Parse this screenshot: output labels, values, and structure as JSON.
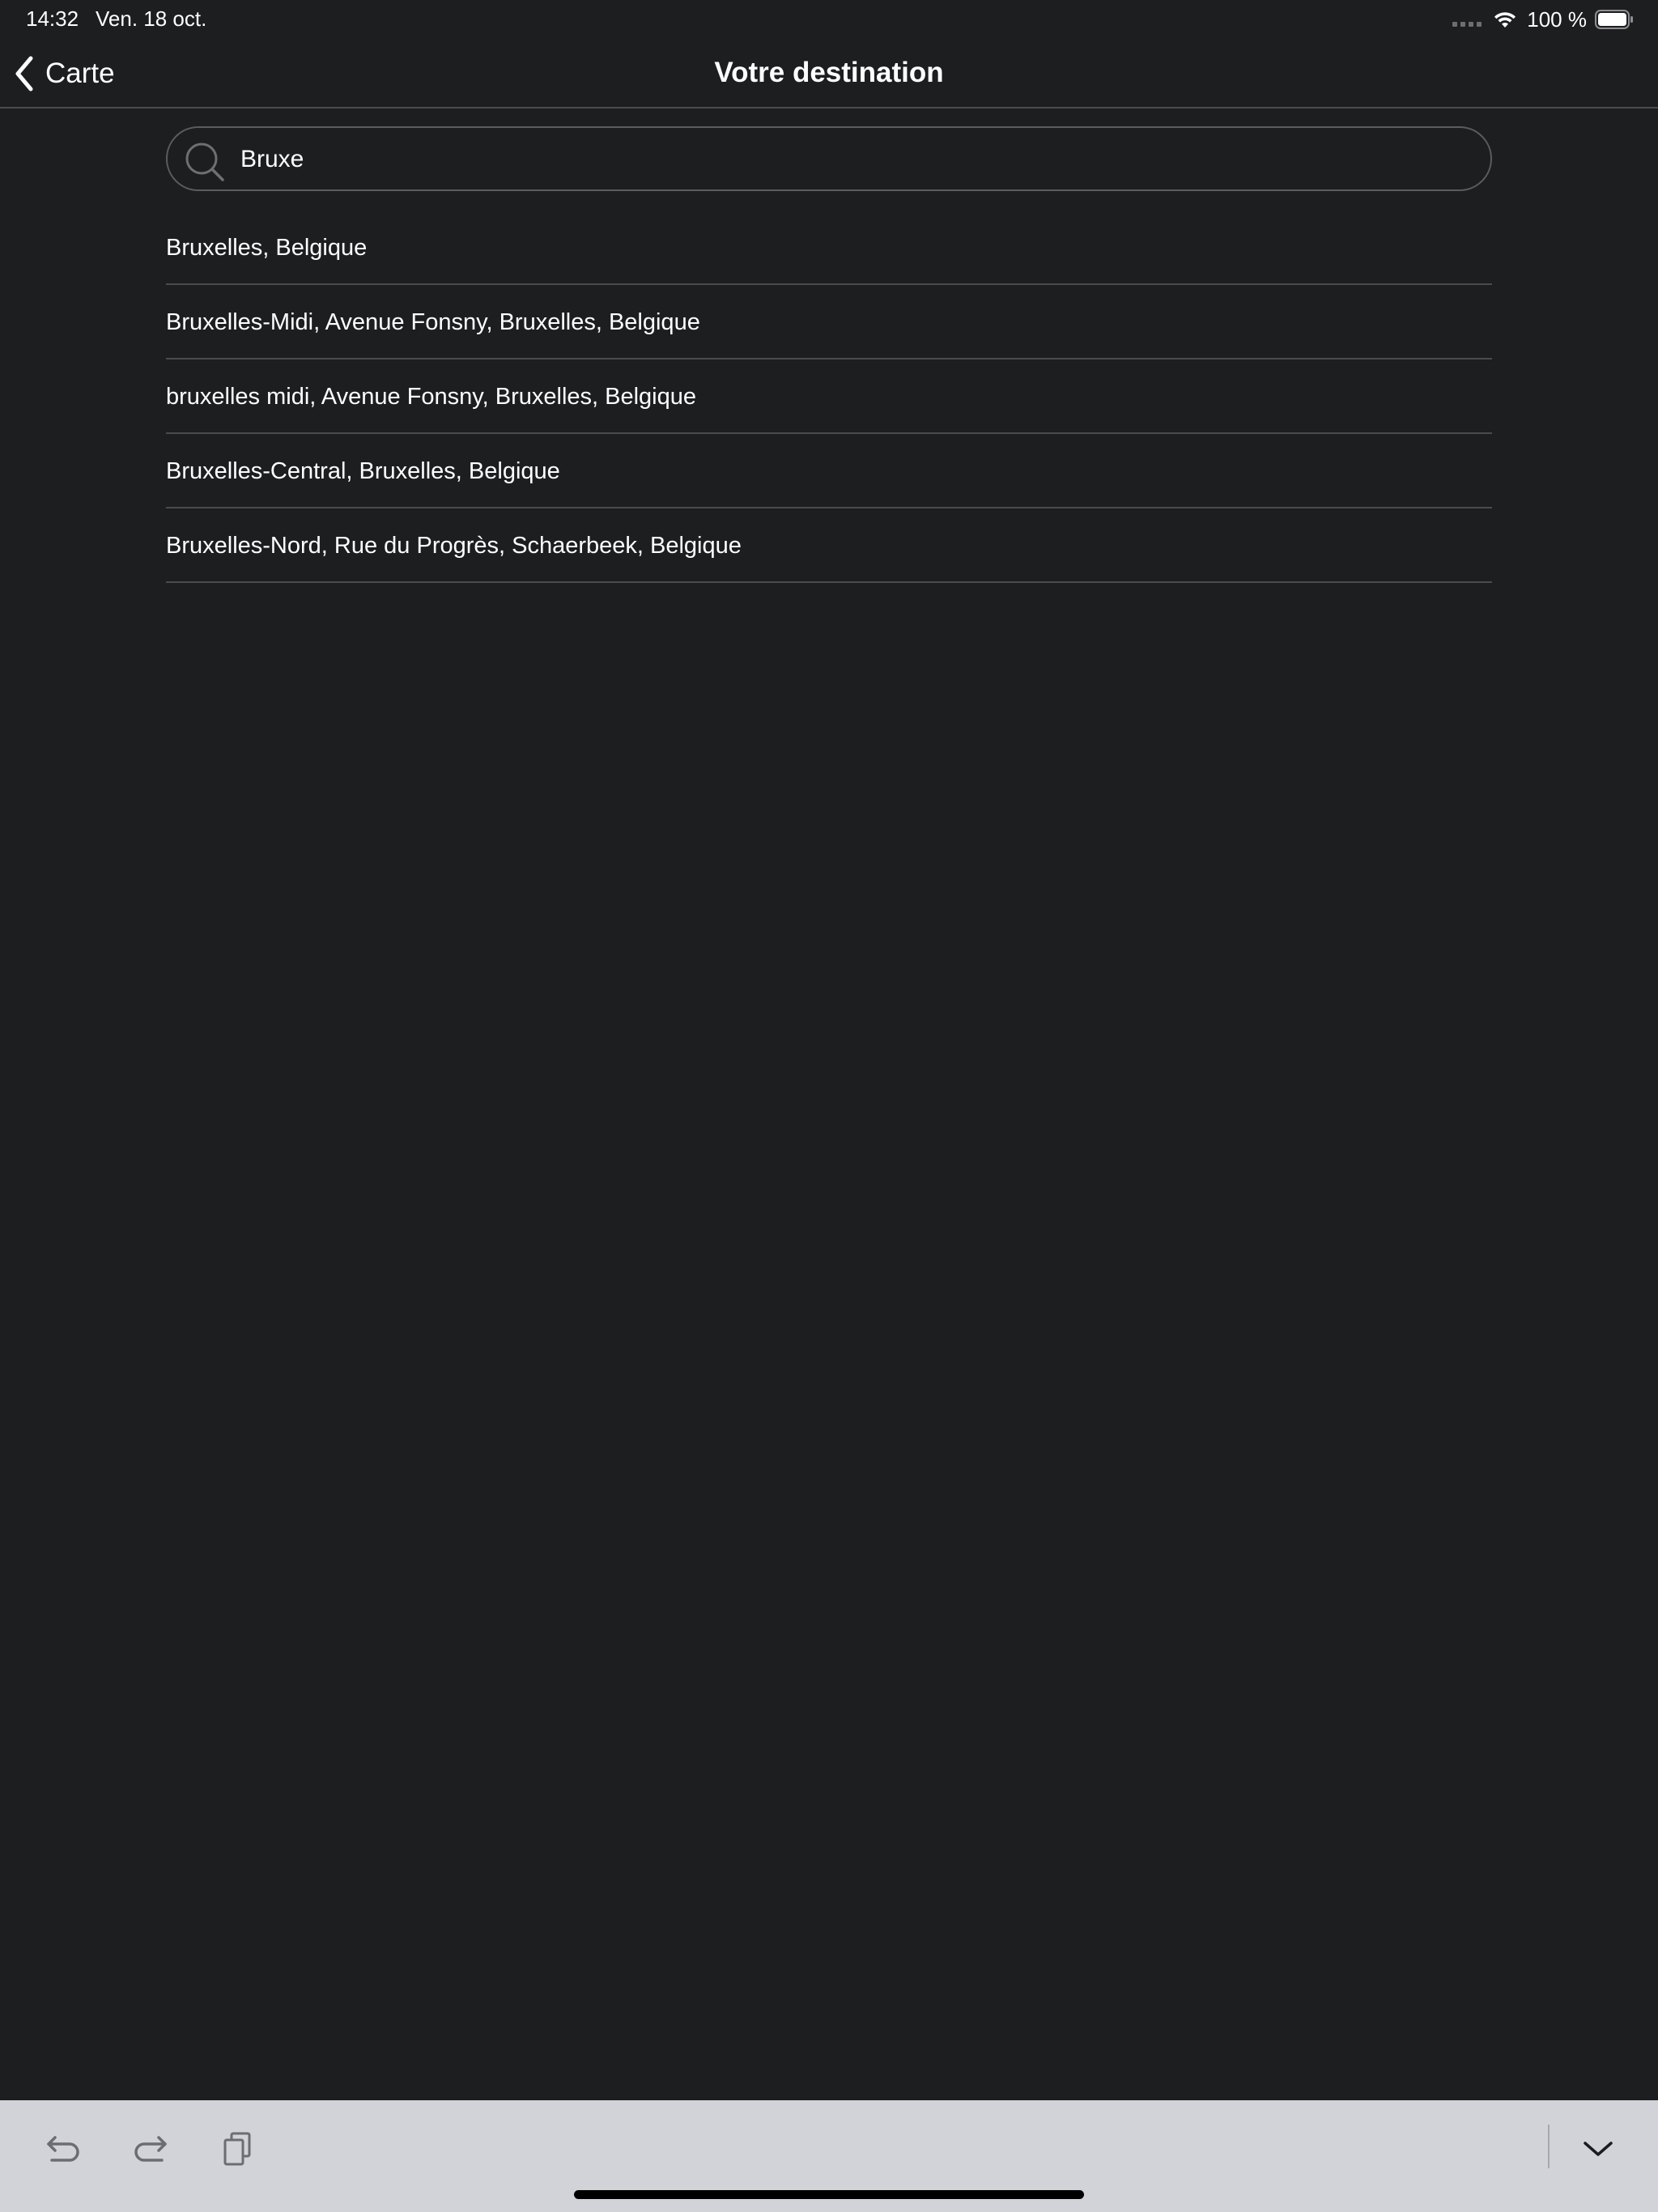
{
  "status_bar": {
    "time": "14:32",
    "date": "Ven. 18 oct.",
    "battery": "100 %",
    "icons": [
      "signal-dots-icon",
      "wifi-icon",
      "battery-icon"
    ]
  },
  "nav": {
    "back_label": "Carte",
    "title": "Votre destination"
  },
  "search": {
    "value": "Bruxe",
    "placeholder": ""
  },
  "results": [
    {
      "label": "Bruxelles, Belgique"
    },
    {
      "label": "Bruxelles-Midi, Avenue Fonsny, Bruxelles, Belgique"
    },
    {
      "label": "bruxelles midi, Avenue Fonsny, Bruxelles, Belgique"
    },
    {
      "label": "Bruxelles-Central, Bruxelles, Belgique"
    },
    {
      "label": "Bruxelles-Nord, Rue du Progrès, Schaerbeek, Belgique"
    }
  ],
  "keyboard_bar": {
    "icons": [
      "undo-icon",
      "redo-icon",
      "paste-icon",
      "keyboard-dismiss-icon"
    ]
  },
  "colors": {
    "background": "#1d1e20",
    "separator": "#4a4b4e",
    "text": "#ffffff",
    "keyboard_bar": "#d1d3d9"
  }
}
